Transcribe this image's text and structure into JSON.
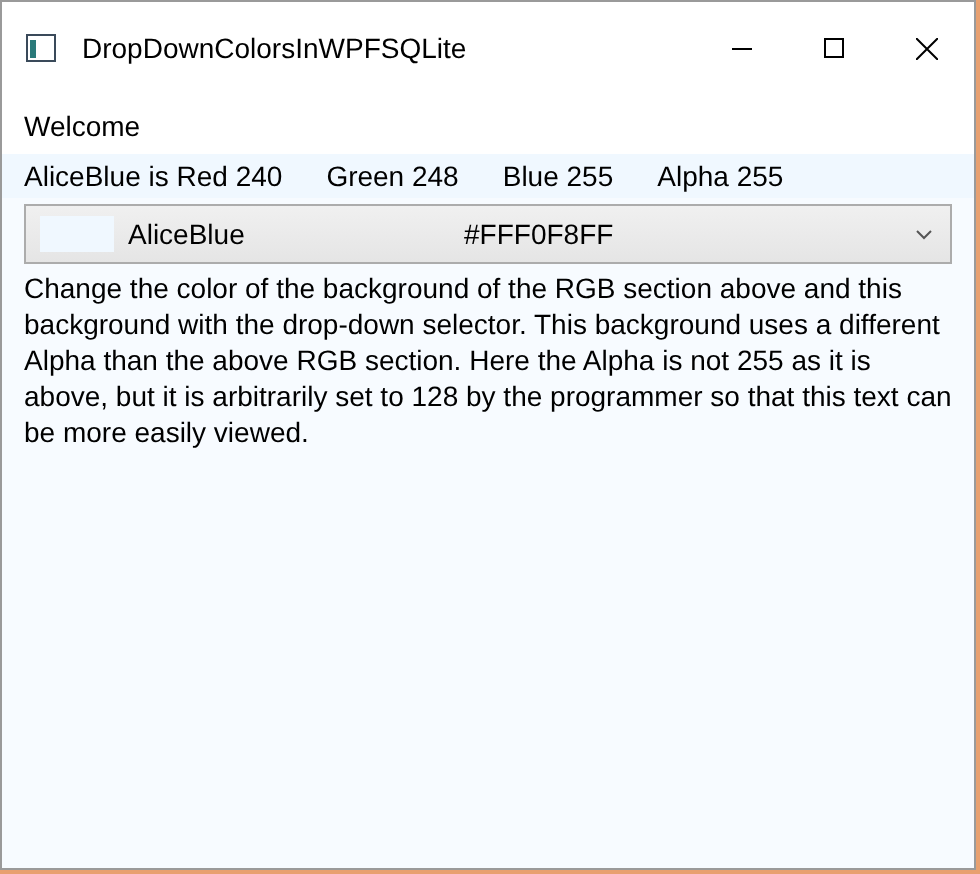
{
  "window": {
    "title": "DropDownColorsInWPFSQLite"
  },
  "welcome": "Welcome",
  "rgb_row": {
    "name_red": "AliceBlue is Red 240",
    "green": "Green 248",
    "blue": "Blue 255",
    "alpha": "Alpha 255"
  },
  "color_dropdown": {
    "color": "#f0f8ff",
    "name": "AliceBlue",
    "hex": "#FFF0F8FF"
  },
  "description": "Change the color of the background of the RGB section above and this background with the drop-down selector. This background uses a different Alpha than the above RGB section. Here the Alpha is not 255 as it is above, but it is arbitrarily set to 128 by the programmer so that this text can be more easily viewed."
}
